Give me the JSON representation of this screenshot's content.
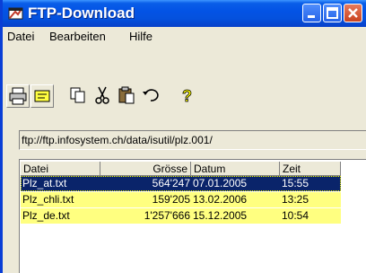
{
  "window": {
    "title": "FTP-Download",
    "icons": [
      "app-icon",
      "minimize-icon",
      "maximize-icon",
      "close-icon"
    ]
  },
  "menu": {
    "file": "Datei",
    "edit": "Bearbeiten",
    "help": "Hilfe"
  },
  "toolbar": {
    "icons": [
      "print-icon",
      "notes-icon",
      "copy-icon",
      "cut-icon",
      "paste-icon",
      "undo-icon",
      "help-icon"
    ]
  },
  "address": {
    "value": "ftp://ftp.infosystem.ch/data/isutil/plz.001/"
  },
  "files": {
    "columns": [
      "Datei",
      "Grösse",
      "Datum",
      "Zeit"
    ],
    "rows": [
      {
        "name": "Plz_at.txt",
        "size": "564'247",
        "date": "07.01.2005",
        "time": "15:55",
        "selected": true
      },
      {
        "name": "Plz_chli.txt",
        "size": "159'205",
        "date": "13.02.2006",
        "time": "13:25",
        "selected": false
      },
      {
        "name": "Plz_de.txt",
        "size": "1'257'666",
        "date": "15.12.2005",
        "time": "10:54",
        "selected": false
      }
    ]
  },
  "colors": {
    "titlebar": "#0353e5",
    "selected_row": "#0a246a",
    "highlight_row": "#ffff80",
    "window_bg": "#ece9d8"
  }
}
